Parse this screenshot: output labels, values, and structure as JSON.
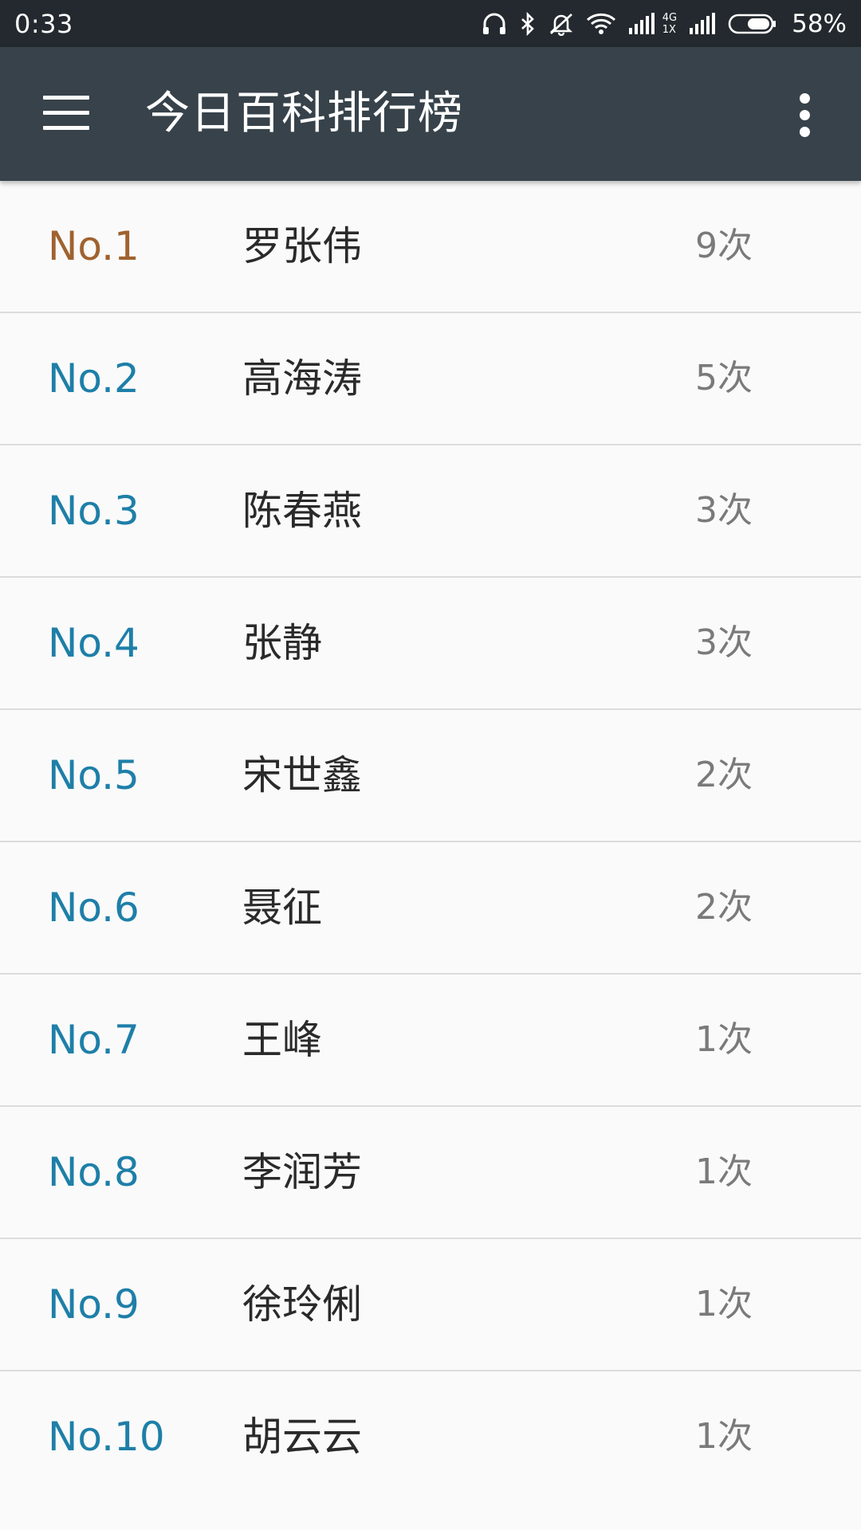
{
  "status_bar": {
    "time": "0:33",
    "network_top": "4G",
    "network_bottom": "1X",
    "battery": "58%",
    "icons": [
      "headset-icon",
      "bluetooth-icon",
      "mute-icon",
      "wifi-icon",
      "signal-icon",
      "signal-icon",
      "battery-icon"
    ]
  },
  "toolbar": {
    "title": "今日百科排行榜",
    "menu_icon": "hamburger-menu-icon",
    "overflow_icon": "more-vert-icon"
  },
  "colors": {
    "status_bar_bg": "#23292e",
    "toolbar_bg": "#37424a",
    "rank_first": "#a0622f",
    "rank_default": "#1e7fa8",
    "count": "#7a7a7a"
  },
  "ranking": [
    {
      "rank": "No.1",
      "name": "罗张伟",
      "count": "9次"
    },
    {
      "rank": "No.2",
      "name": "高海涛",
      "count": "5次"
    },
    {
      "rank": "No.3",
      "name": "陈春燕",
      "count": "3次"
    },
    {
      "rank": "No.4",
      "name": "张静",
      "count": "3次"
    },
    {
      "rank": "No.5",
      "name": "宋世鑫",
      "count": "2次"
    },
    {
      "rank": "No.6",
      "name": "聂征",
      "count": "2次"
    },
    {
      "rank": "No.7",
      "name": "王峰",
      "count": "1次"
    },
    {
      "rank": "No.8",
      "name": "李润芳",
      "count": "1次"
    },
    {
      "rank": "No.9",
      "name": "徐玲俐",
      "count": "1次"
    },
    {
      "rank": "No.10",
      "name": "胡云云",
      "count": "1次"
    }
  ]
}
